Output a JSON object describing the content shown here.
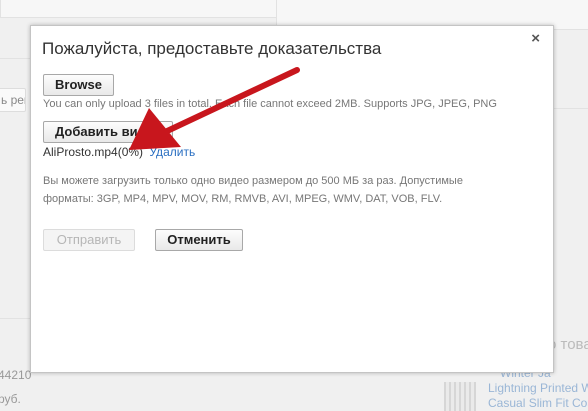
{
  "background": {
    "left_button_fragment": "ь реш",
    "side_heading_fragment": "о това",
    "left_number_fragment": "44210",
    "left_text_fragment": "руб.",
    "product_links": [
      "Winter Ja",
      "Lightning Printed W",
      "Casual Slim Fit Coa"
    ]
  },
  "modal": {
    "title": "Пожалуйста, предоставьте доказательства",
    "close_label": "×",
    "browse_label": "Browse",
    "upload_note": "You can only upload 3 files in total. Each file cannot exceed 2MB. Supports JPG, JPEG, PNG",
    "add_video_label": "Добавить видео",
    "file_name": "AliProsto.mp4(0%)",
    "delete_label": "Удалить",
    "video_note": "Вы можете загрузить только одно видео размером до 500 МБ за раз. Допустимые форматы: 3GP, MP4, MPV, MOV, RM, RMVB, AVI, MPEG, WMV, DAT, VOB, FLV.",
    "submit_label": "Отправить",
    "cancel_label": "Отменить"
  },
  "colors": {
    "arrow": "#c8161d",
    "link": "#2a6fc2",
    "disabled_text": "#b6b6b6"
  },
  "annotation": {
    "type": "red-arrow-pointer"
  }
}
